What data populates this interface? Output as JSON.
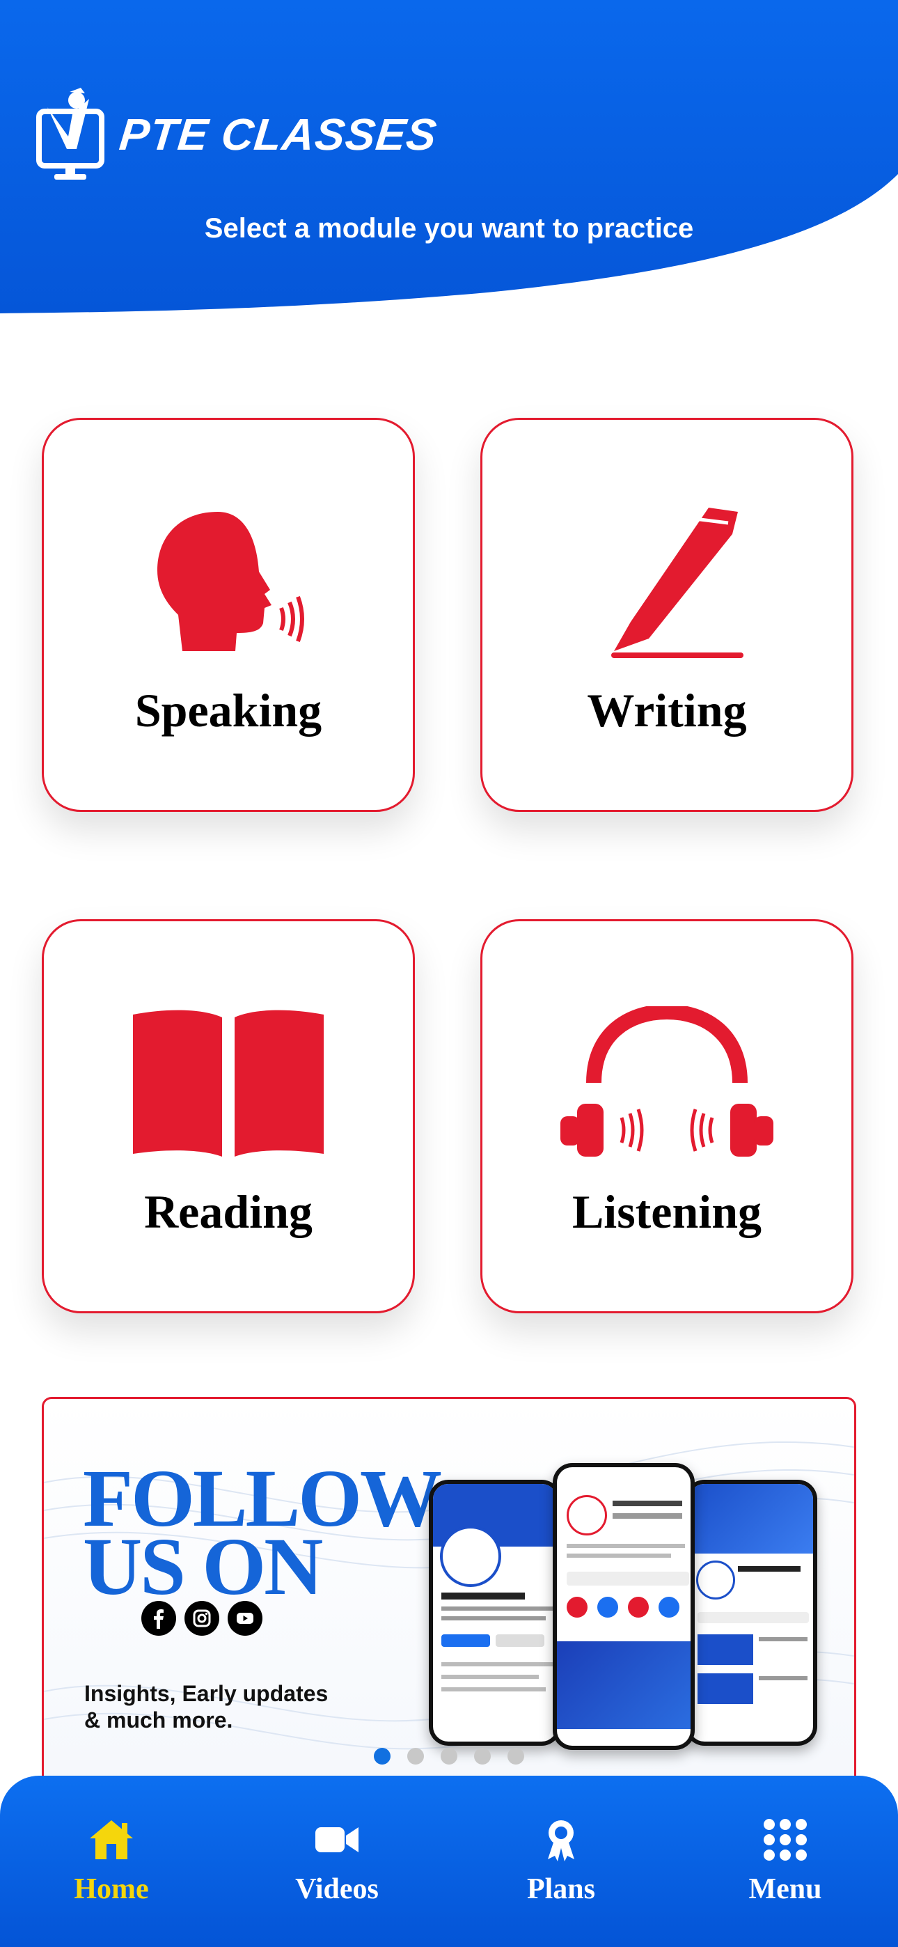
{
  "header": {
    "brand": "PTE CLASSES",
    "subtitle": "Select a module you want to practice"
  },
  "modules": [
    {
      "label": "Speaking",
      "icon": "speaking-head-icon"
    },
    {
      "label": "Writing",
      "icon": "pen-icon"
    },
    {
      "label": "Reading",
      "icon": "open-book-icon"
    },
    {
      "label": "Listening",
      "icon": "headphones-icon"
    }
  ],
  "banner": {
    "title_line1": "FOLLOW",
    "title_line2": "US ON",
    "subtitle_line1": "Insights, Early updates",
    "subtitle_line2": "& much more.",
    "social_icons": [
      "facebook-icon",
      "instagram-icon",
      "youtube-icon"
    ],
    "carousel_pages": 5,
    "carousel_active": 1
  },
  "nav": {
    "items": [
      {
        "label": "Home",
        "icon": "home-icon",
        "active": true
      },
      {
        "label": "Videos",
        "icon": "video-camera-icon",
        "active": false
      },
      {
        "label": "Plans",
        "icon": "award-badge-icon",
        "active": false
      },
      {
        "label": "Menu",
        "icon": "grid-menu-icon",
        "active": false
      }
    ]
  },
  "colors": {
    "primary_blue": "#0a63e6",
    "accent_red": "#e31b2f",
    "active_nav": "#f5d60c"
  }
}
